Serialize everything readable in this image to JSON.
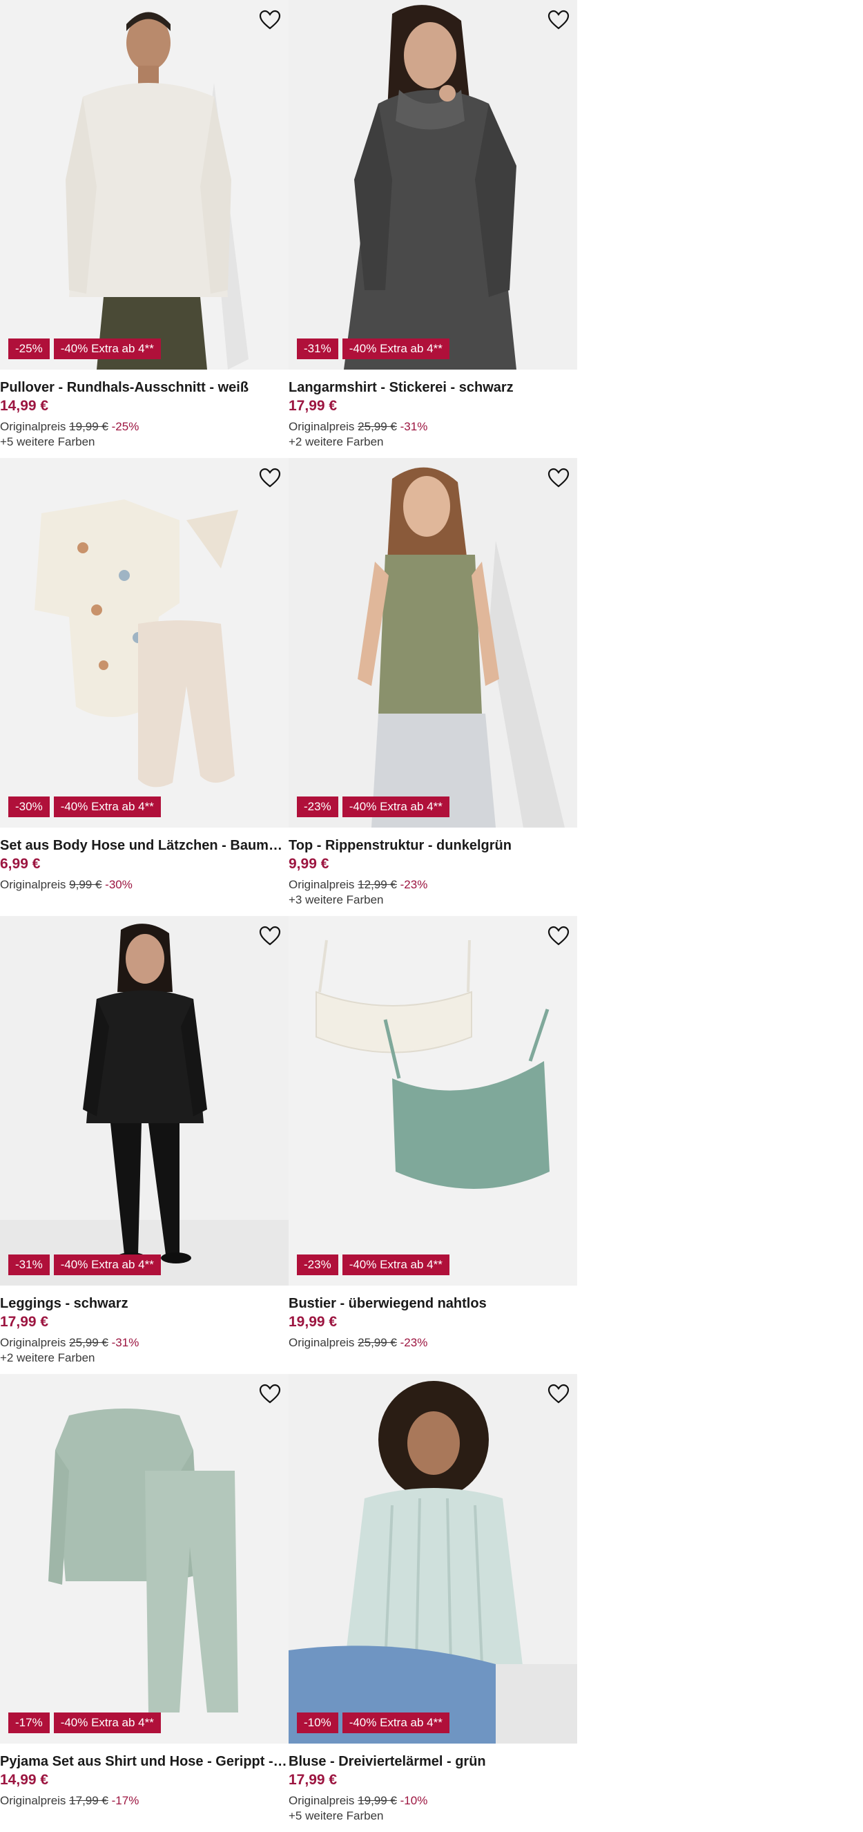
{
  "labels": {
    "original_price": "Originalpreis"
  },
  "colors": {
    "badge_bg": "#b0103a",
    "price": "#9c1540",
    "image_bg": "#f2f2f2"
  },
  "products": [
    {
      "title": "Pullover - Rundhals-Ausschnitt - weiß",
      "price": "14,99 €",
      "original_price": "19,99 €",
      "discount_text": "-25%",
      "badge_discount": "-25%",
      "badge_extra": "-40% Extra ab 4**",
      "more_colors": "+5 weitere Farben",
      "image": "man-white-pullover",
      "garment_color": "#ece9e3"
    },
    {
      "title": "Langarmshirt - Stickerei - schwarz",
      "price": "17,99 €",
      "original_price": "25,99 €",
      "discount_text": "-31%",
      "badge_discount": "-31%",
      "badge_extra": "-40% Extra ab 4**",
      "more_colors": "+2 weitere Farben",
      "image": "woman-grey-longsleeve",
      "garment_color": "#4a4a4a"
    },
    {
      "title": "Set aus Body Hose und Lätzchen - Baumwolle - ecru",
      "price": "6,99 €",
      "original_price": "9,99 €",
      "discount_text": "-30%",
      "badge_discount": "-30%",
      "badge_extra": "-40% Extra ab 4**",
      "more_colors": "",
      "image": "baby-body-set",
      "garment_color": "#f1ece0"
    },
    {
      "title": "Top - Rippenstruktur - dunkelgrün",
      "price": "9,99 €",
      "original_price": "12,99 €",
      "discount_text": "-23%",
      "badge_discount": "-23%",
      "badge_extra": "-40% Extra ab 4**",
      "more_colors": "+3 weitere Farben",
      "image": "woman-green-top",
      "garment_color": "#8a916c"
    },
    {
      "title": "Leggings - schwarz",
      "price": "17,99 €",
      "original_price": "25,99 €",
      "discount_text": "-31%",
      "badge_discount": "-31%",
      "badge_extra": "-40% Extra ab 4**",
      "more_colors": "+2 weitere Farben",
      "image": "woman-black-outfit",
      "garment_color": "#1c1c1c"
    },
    {
      "title": "Bustier - überwiegend nahtlos",
      "price": "19,99 €",
      "original_price": "25,99 €",
      "discount_text": "-23%",
      "badge_discount": "-23%",
      "badge_extra": "-40% Extra ab 4**",
      "more_colors": "",
      "image": "bustier-set",
      "garment_color": "#7fa89a"
    },
    {
      "title": "Pyjama Set aus Shirt und Hose - Gerippt - helles mint",
      "price": "14,99 €",
      "original_price": "17,99 €",
      "discount_text": "-17%",
      "badge_discount": "-17%",
      "badge_extra": "-40% Extra ab 4**",
      "more_colors": "",
      "image": "pyjama-set",
      "garment_color": "#a9bfb2"
    },
    {
      "title": "Bluse - Dreiviertelärmel - grün",
      "price": "17,99 €",
      "original_price": "19,99 €",
      "discount_text": "-10%",
      "badge_discount": "-10%",
      "badge_extra": "-40% Extra ab 4**",
      "more_colors": "+5 weitere Farben",
      "image": "woman-striped-blouse",
      "garment_color": "#cfe0dc"
    }
  ]
}
